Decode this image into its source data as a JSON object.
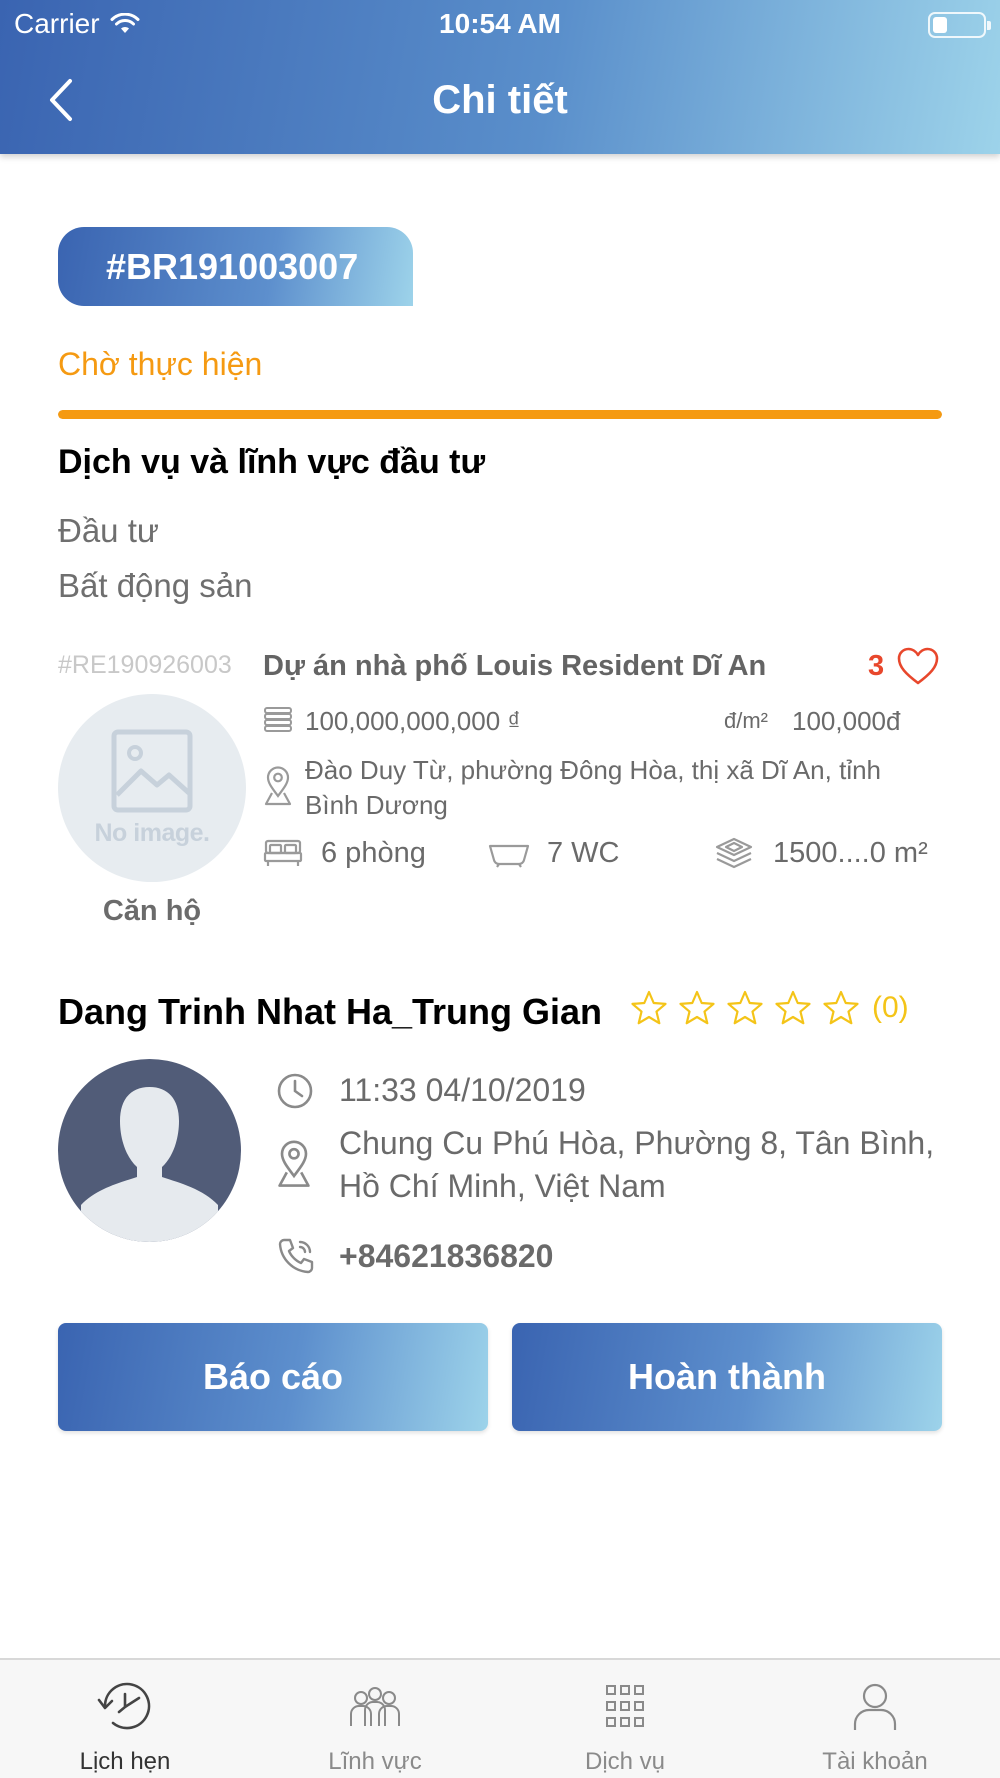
{
  "status_bar": {
    "carrier": "Carrier",
    "time": "10:54 AM",
    "battery_level": 0.2
  },
  "header": {
    "title": "Chi tiết",
    "back_icon": "chevron-left-icon"
  },
  "booking": {
    "id": "#BR191003007",
    "status": "Chờ thực hiện",
    "status_color": "#f59a12",
    "progress": 1.0
  },
  "service_section": {
    "title": "Dịch vụ và lĩnh vực đầu tư",
    "lines": [
      "Đầu tư",
      "Bất động sản"
    ]
  },
  "property": {
    "code": "#RE190926003",
    "title": "Dự án nhà phố Louis Resident Dĩ An",
    "likes": "3",
    "price": "100,000,000,000 ₫",
    "price_per_m2_label": "đ/m²",
    "price_per_m2": "100,000đ",
    "address_line1": "Đào Duy Từ, phường Đông Hòa, thị xã Dĩ An, tỉnh",
    "address_line2": "Bình Dương",
    "rooms": "6 phòng",
    "wc": "7 WC",
    "area": "1500....0 m²",
    "type": "Căn hộ",
    "image_placeholder": "No image."
  },
  "agent": {
    "name": "Dang Trinh Nhat Ha_Trung Gian",
    "rating": 0,
    "rating_count": "(0)",
    "datetime": "11:33 04/10/2019",
    "address_line1": "Chung Cu Phú Hòa, Phường 8, Tân Bình,",
    "address_line2": "Hồ Chí Minh, Việt Nam",
    "phone": "+84621836820"
  },
  "actions": {
    "report": "Báo cáo",
    "complete": "Hoàn thành"
  },
  "tabs": [
    {
      "label": "Lịch hẹn",
      "icon": "clock-history-icon",
      "active": true
    },
    {
      "label": "Lĩnh vực",
      "icon": "people-group-icon",
      "active": false
    },
    {
      "label": "Dịch vụ",
      "icon": "grid-icon",
      "active": false
    },
    {
      "label": "Tài khoản",
      "icon": "user-icon",
      "active": false
    }
  ],
  "colors": {
    "brand_gradient_start": "#3a64b1",
    "brand_gradient_end": "#9dd3ea",
    "like_red": "#e8472c",
    "star_yellow": "#f4c418"
  }
}
